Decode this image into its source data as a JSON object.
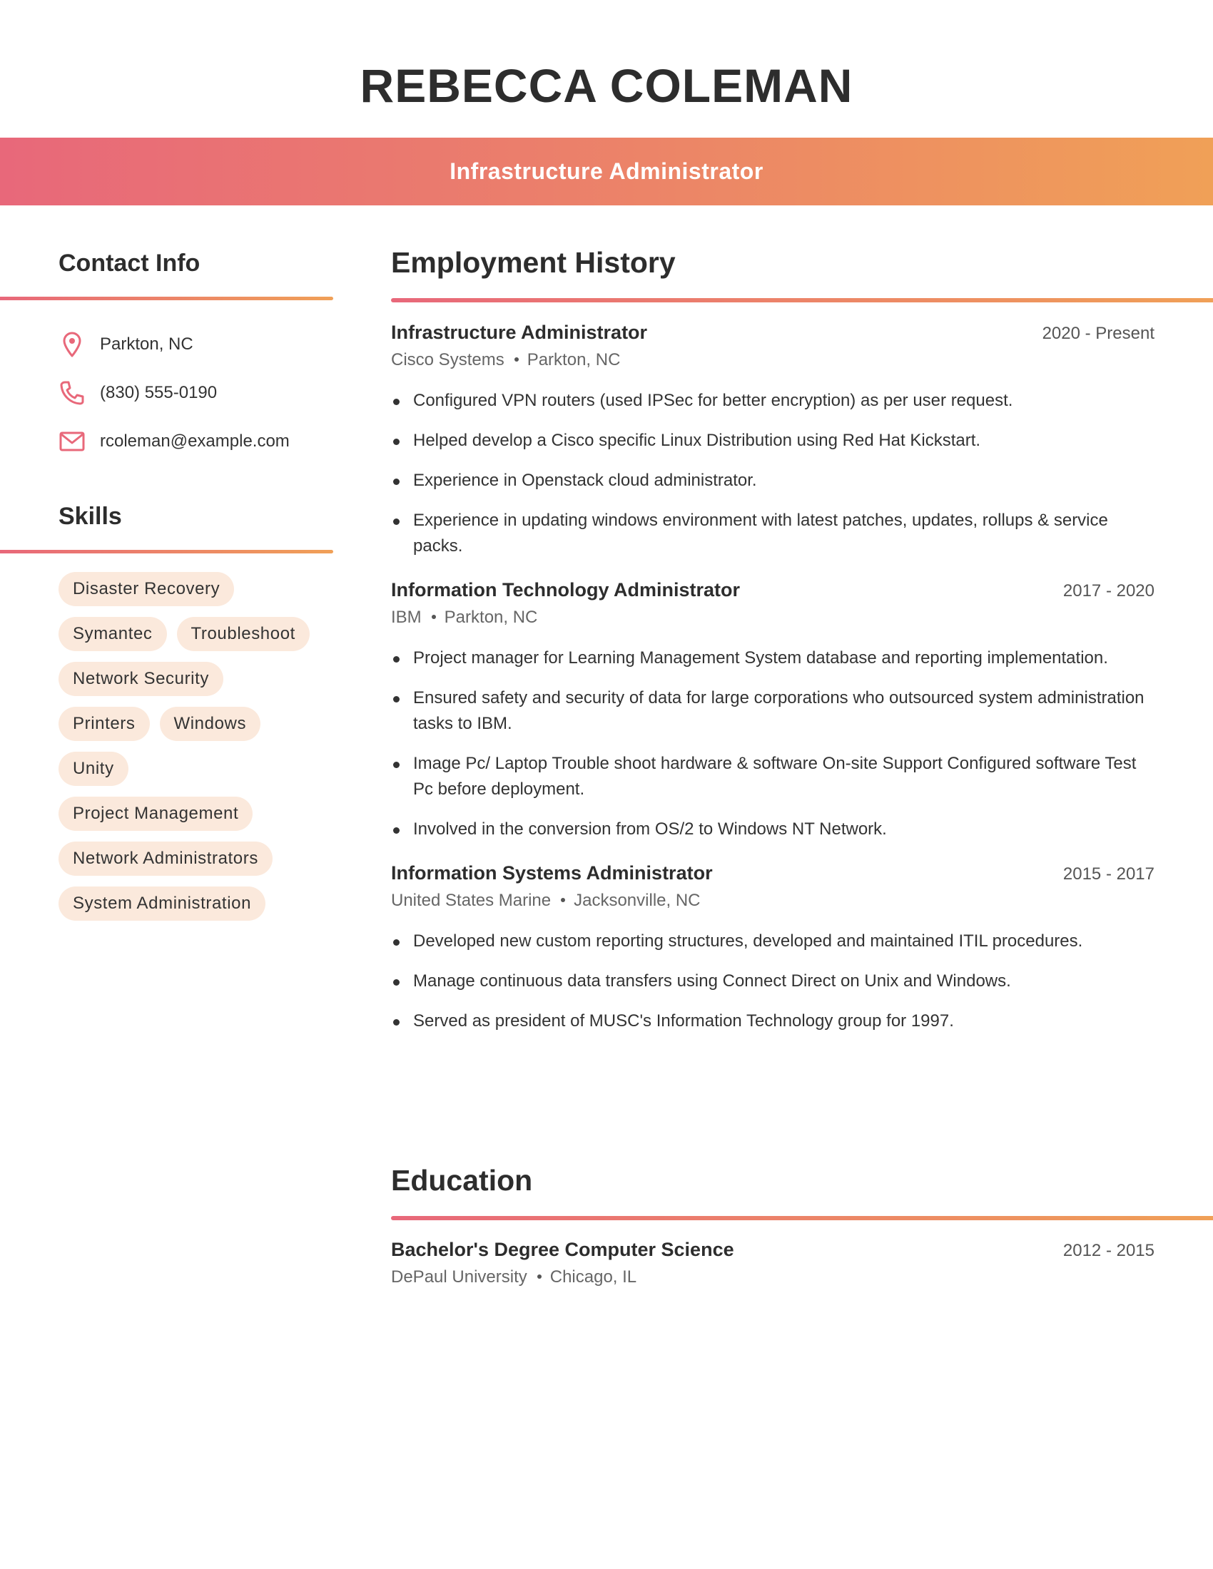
{
  "header": {
    "name": "REBECCA COLEMAN",
    "title": "Infrastructure Administrator",
    "gradient_start": "#e8687a",
    "gradient_end": "#f0a057"
  },
  "contact": {
    "heading": "Contact Info",
    "items": [
      {
        "icon": "location-pin-icon",
        "text": "Parkton, NC"
      },
      {
        "icon": "phone-icon",
        "text": "(830) 555-0190"
      },
      {
        "icon": "mail-icon",
        "text": "rcoleman@example.com"
      }
    ]
  },
  "skills": {
    "heading": "Skills",
    "chip_color": "#fbe9dc",
    "items": [
      "Disaster Recovery",
      "Symantec",
      "Troubleshoot",
      "Network Security",
      "Printers",
      "Windows",
      "Unity",
      "Project Management",
      "Network Administrators",
      "System Administration"
    ]
  },
  "employment": {
    "heading": "Employment History",
    "jobs": [
      {
        "title": "Infrastructure Administrator",
        "dates": "2020 - Present",
        "company": "Cisco Systems",
        "location": "Parkton, NC",
        "bullets": [
          "Configured VPN routers (used IPSec for better encryption) as per user request.",
          "Helped develop a Cisco specific Linux Distribution using Red Hat Kickstart.",
          "Experience in Openstack cloud administrator.",
          "Experience in updating windows environment with latest patches, updates, rollups & service packs."
        ]
      },
      {
        "title": "Information Technology Administrator",
        "dates": "2017 - 2020",
        "company": "IBM",
        "location": "Parkton, NC",
        "bullets": [
          "Project manager for Learning Management System database and reporting implementation.",
          "Ensured safety and security of data for large corporations who outsourced system administration tasks to IBM.",
          "Image Pc/ Laptop Trouble shoot hardware & software On-site Support Configured software Test Pc before deployment.",
          "Involved in the conversion from OS/2 to Windows NT Network."
        ]
      },
      {
        "title": "Information Systems Administrator",
        "dates": "2015 - 2017",
        "company": "United States Marine",
        "location": "Jacksonville, NC",
        "bullets": [
          "Developed new custom reporting structures, developed and maintained ITIL procedures.",
          "Manage continuous data transfers using Connect Direct on Unix and Windows.",
          "Served as president of MUSC's Information Technology group for 1997."
        ]
      }
    ]
  },
  "education": {
    "heading": "Education",
    "entries": [
      {
        "degree": "Bachelor's Degree Computer Science",
        "dates": "2012 - 2015",
        "school": "DePaul University",
        "location": "Chicago, IL"
      }
    ]
  }
}
